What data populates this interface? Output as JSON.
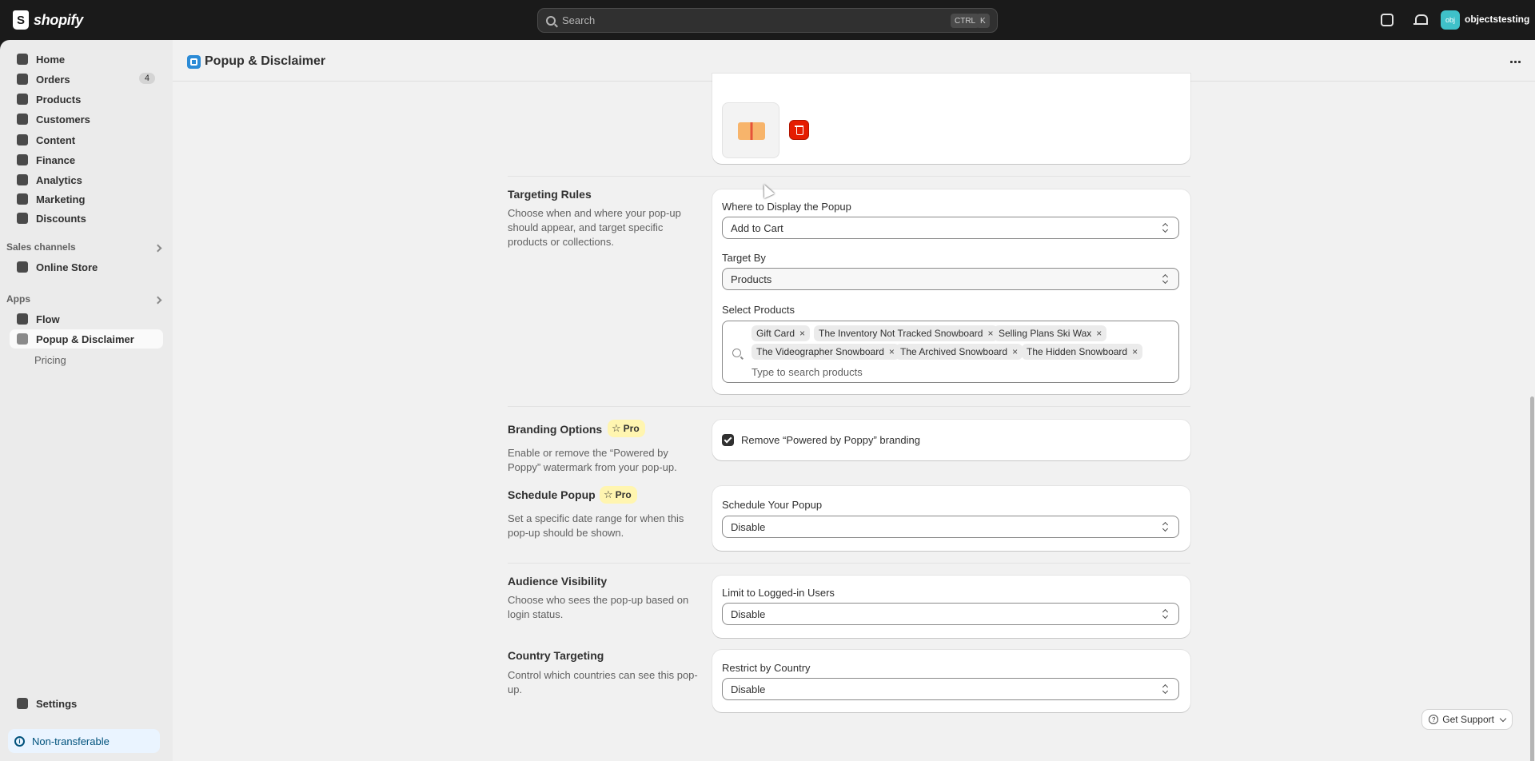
{
  "topbar": {
    "brand": "shopify",
    "search_placeholder": "Search",
    "shortcut_ctrl": "CTRL",
    "shortcut_key": "K",
    "avatar_initials": "obj",
    "store_name": "objectstesting"
  },
  "sidebar": {
    "items": [
      {
        "label": "Home"
      },
      {
        "label": "Orders",
        "badge": "4"
      },
      {
        "label": "Products"
      },
      {
        "label": "Customers"
      },
      {
        "label": "Content"
      },
      {
        "label": "Finance"
      },
      {
        "label": "Analytics"
      },
      {
        "label": "Marketing"
      },
      {
        "label": "Discounts"
      }
    ],
    "sales_channels_label": "Sales channels",
    "online_store": "Online Store",
    "apps_label": "Apps",
    "flow": "Flow",
    "popup_app": "Popup & Disclaimer",
    "pricing": "Pricing",
    "settings": "Settings",
    "non_transferable": "Non-transferable"
  },
  "page": {
    "title": "Popup & Disclaimer"
  },
  "targeting": {
    "title": "Targeting Rules",
    "description": "Choose when and where your pop-up should appear, and target specific products or collections.",
    "where_label": "Where to Display the Popup",
    "where_value": "Add to Cart",
    "target_by_label": "Target By",
    "target_by_value": "Products",
    "select_products_label": "Select Products",
    "tags": [
      "Gift Card",
      "The Inventory Not Tracked Snowboard",
      "Selling Plans Ski Wax",
      "The Videographer Snowboard",
      "The Archived Snowboard",
      "The Hidden Snowboard"
    ],
    "search_placeholder": "Type to search products"
  },
  "branding": {
    "title": "Branding Options",
    "pro": "Pro",
    "description": "Enable or remove the “Powered by Poppy” watermark from your pop-up.",
    "checkbox_label": "Remove “Powered by Poppy” branding",
    "checked": true
  },
  "schedule": {
    "title": "Schedule Popup",
    "pro": "Pro",
    "description": "Set a specific date range for when this pop-up should be shown.",
    "field_label": "Schedule Your Popup",
    "value": "Disable"
  },
  "audience": {
    "title": "Audience Visibility",
    "description": "Choose who sees the pop-up based on login status.",
    "field_label": "Limit to Logged-in Users",
    "value": "Disable"
  },
  "country": {
    "title": "Country Targeting",
    "description": "Control which countries can see this pop-up.",
    "field_label": "Restrict by Country",
    "value": "Disable"
  },
  "support": {
    "label": "Get Support"
  }
}
